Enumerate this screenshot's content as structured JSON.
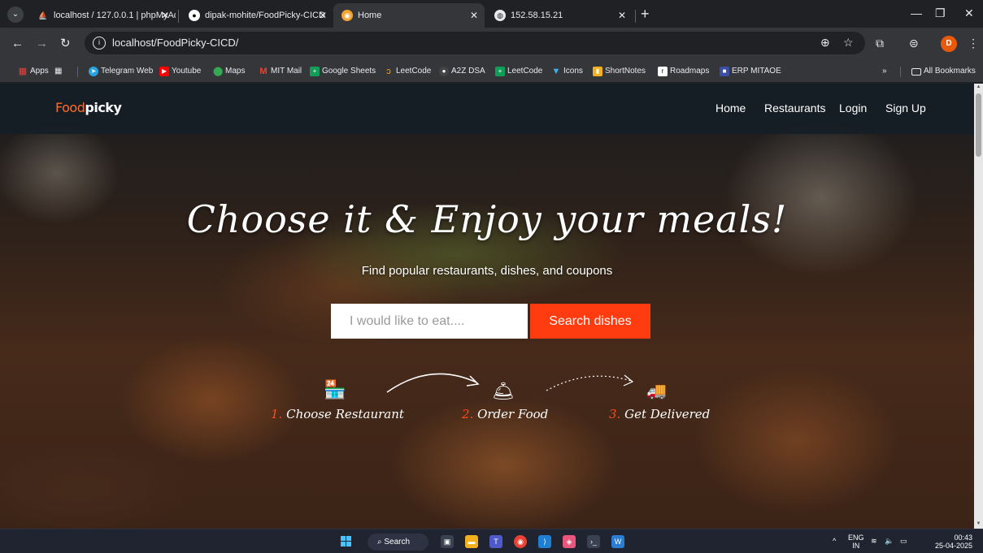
{
  "browser": {
    "tabs": [
      {
        "title": "localhost / 127.0.0.1 | phpMyAd",
        "favicon": "phpmyadmin-icon",
        "active": false
      },
      {
        "title": "dipak-mohite/FoodPicky-CICD",
        "favicon": "github-icon",
        "active": false
      },
      {
        "title": "Home",
        "favicon": "site-icon",
        "active": true
      },
      {
        "title": "152.58.15.21",
        "favicon": "globe-icon",
        "active": false
      }
    ],
    "url": "localhost/FoodPicky-CICD/",
    "profile_initial": "D",
    "bookmarks": [
      {
        "label": "Apps",
        "color": "#e94235"
      },
      {
        "label": "Telegram Web",
        "color": "#2aa3e0"
      },
      {
        "label": "Youtube",
        "color": "#ff0000"
      },
      {
        "label": "Maps",
        "color": "#34a853"
      },
      {
        "label": "MIT Mail",
        "color": "#ea4335"
      },
      {
        "label": "Google Sheets",
        "color": "#0f9d58"
      },
      {
        "label": "LeetCode",
        "color": "#ffa116"
      },
      {
        "label": "A2Z DSA",
        "color": "#444444"
      },
      {
        "label": "LeetCode",
        "color": "#0f9d58"
      },
      {
        "label": "Icons",
        "color": "#3fb0e8"
      },
      {
        "label": "ShortNotes",
        "color": "#f2b01e"
      },
      {
        "label": "Roadmaps",
        "color": "#333333"
      },
      {
        "label": "ERP MITAOE",
        "color": "#3b4ea8"
      }
    ],
    "more_bookmarks": "»",
    "all_bookmarks": "All Bookmarks"
  },
  "site": {
    "logo_part1": "Food",
    "logo_part2": "picky",
    "nav": [
      "Home",
      "Restaurants",
      "Login",
      "Sign Up"
    ],
    "headline": "Choose it & Enjoy your meals!",
    "subline": "Find popular restaurants, dishes, and coupons",
    "search_placeholder": "I would like to eat....",
    "search_button": "Search dishes",
    "steps": [
      {
        "num": "1.",
        "label": "Choose Restaurant",
        "icon": "store-icon"
      },
      {
        "num": "2.",
        "label": "Order Food",
        "icon": "cloche-icon"
      },
      {
        "num": "3.",
        "label": "Get Delivered",
        "icon": "delivery-truck-icon"
      }
    ]
  },
  "taskbar": {
    "search_label": "Search",
    "lang_top": "ENG",
    "lang_bottom": "IN",
    "time": "00:43",
    "date": "25-04-2025"
  },
  "colors": {
    "accent": "#ff3b0f",
    "logo_orange": "#ff6a2b",
    "nav_bg": "#161e26"
  }
}
